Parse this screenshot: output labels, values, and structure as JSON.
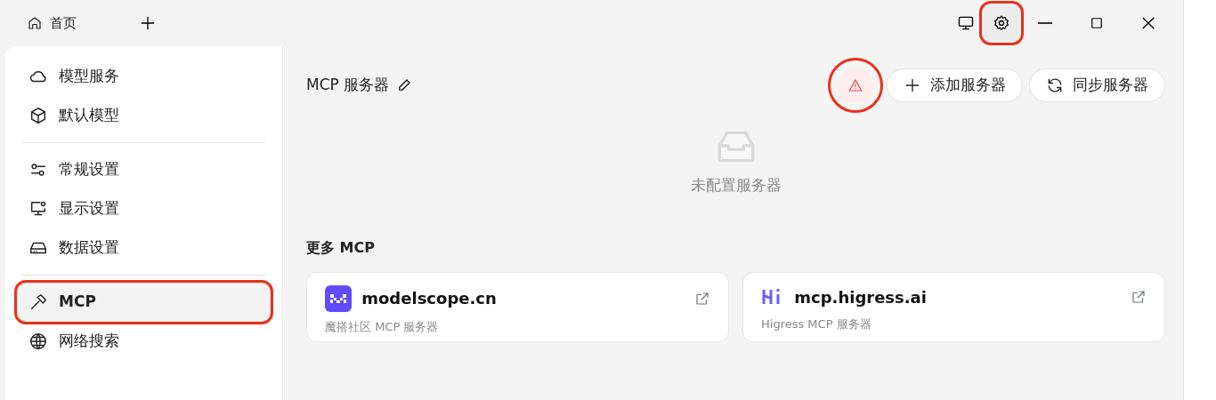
{
  "tabs": [
    {
      "label": "首页",
      "selected": true
    }
  ],
  "titlebar": {
    "settings_highlighted": true
  },
  "sidebar": {
    "groups": [
      {
        "items": [
          {
            "label": "模型服务",
            "selected": false,
            "highlighted": false
          },
          {
            "label": "默认模型",
            "selected": false,
            "highlighted": false
          }
        ]
      },
      {
        "items": [
          {
            "label": "常规设置",
            "selected": false,
            "highlighted": false
          },
          {
            "label": "显示设置",
            "selected": false,
            "highlighted": false
          },
          {
            "label": "数据设置",
            "selected": false,
            "highlighted": false
          }
        ]
      },
      {
        "items": [
          {
            "label": "MCP",
            "selected": true,
            "highlighted": true
          },
          {
            "label": "网络搜索",
            "selected": false,
            "highlighted": false
          }
        ]
      }
    ]
  },
  "header": {
    "title": "MCP 服务器",
    "warning_highlighted": true,
    "buttons": [
      "添加服务器",
      "同步服务器"
    ]
  },
  "empty_state": {
    "text": "未配置服务器"
  },
  "more": {
    "title": "更多 MCP",
    "cards": [
      {
        "name": "modelscope.cn",
        "description": "魔搭社区 MCP 服务器"
      },
      {
        "name": "mcp.higress.ai",
        "description": "Higress MCP 服务器"
      }
    ]
  }
}
